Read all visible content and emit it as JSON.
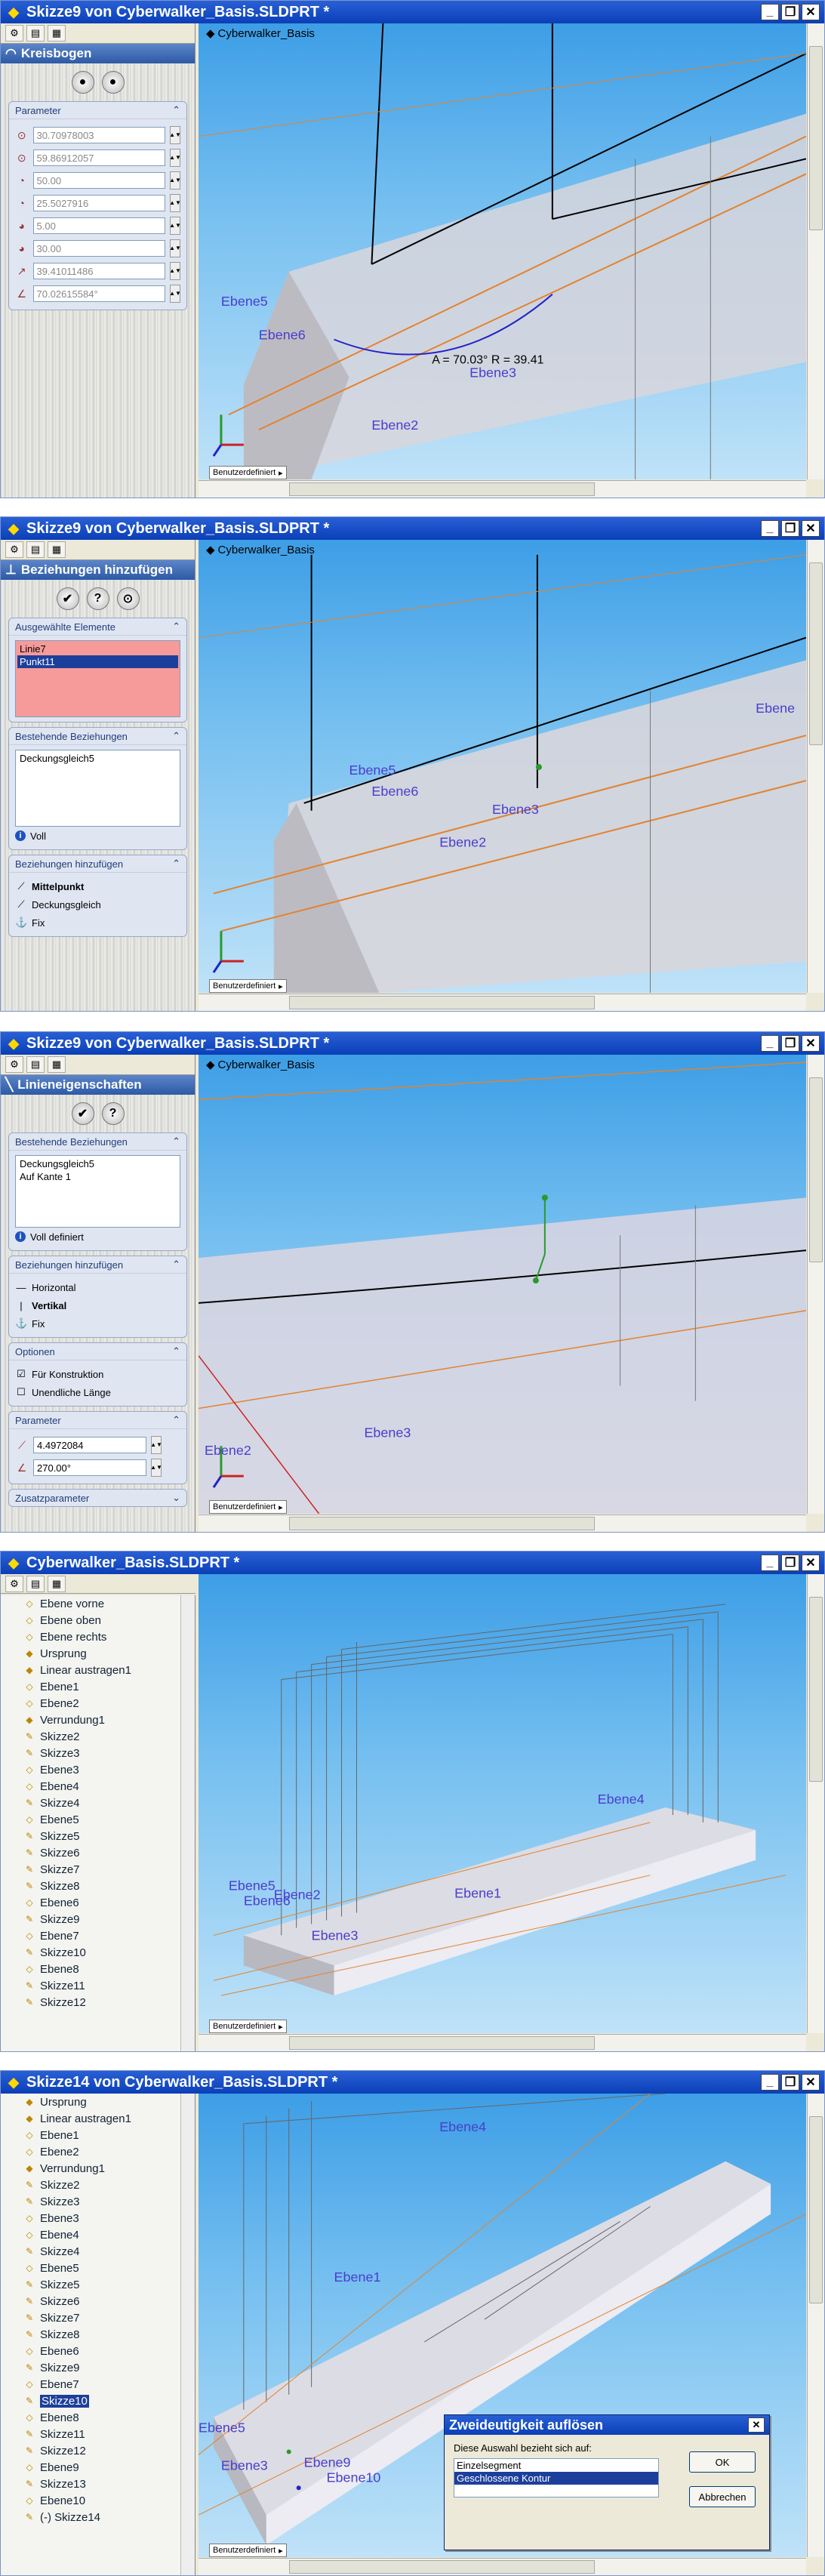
{
  "w1": {
    "title": "Skizze9 von Cyberwalker_Basis.SLDPRT *",
    "pm_title": "Kreisbogen",
    "param_label": "Parameter",
    "params": [
      "30.70978003",
      "59.86912057",
      "50.00",
      "25.5027916",
      "5.00",
      "30.00",
      "39.41011486",
      "70.02615584°"
    ],
    "viewport_title": "Cyberwalker_Basis",
    "annotation": "A = 70.03° R = 39.41",
    "labels": [
      "Ebene5",
      "Ebene6",
      "Ebene3",
      "Ebene2"
    ],
    "view_tab": "Benutzerdefiniert"
  },
  "w2": {
    "title": "Skizze9 von Cyberwalker_Basis.SLDPRT *",
    "pm_title": "Beziehungen hinzufügen",
    "selected_label": "Ausgewählte Elemente",
    "selected": [
      "Linie7",
      "Punkt11"
    ],
    "existing_label": "Bestehende Beziehungen",
    "existing": [
      "Deckungsgleich5"
    ],
    "status": "Voll",
    "add_label": "Beziehungen hinzufügen",
    "add": [
      "Mittelpunkt",
      "Deckungsgleich",
      "Fix"
    ],
    "viewport_title": "Cyberwalker_Basis",
    "labels": [
      "Ebene5",
      "Ebene6",
      "Ebene3",
      "Ebene2",
      "Ebene"
    ],
    "view_tab": "Benutzerdefiniert"
  },
  "w3": {
    "title": "Skizze9 von Cyberwalker_Basis.SLDPRT *",
    "pm_title": "Linieneigenschaften",
    "existing_label": "Bestehende Beziehungen",
    "existing": [
      "Deckungsgleich5",
      "Auf Kante 1"
    ],
    "status": "Voll definiert",
    "add_label": "Beziehungen hinzufügen",
    "add": [
      "Horizontal",
      "Vertikal",
      "Fix"
    ],
    "options_label": "Optionen",
    "options": [
      "Für Konstruktion",
      "Unendliche Länge"
    ],
    "param_label": "Parameter",
    "params": [
      "4.4972084",
      "270.00°"
    ],
    "extra_label": "Zusatzparameter",
    "viewport_title": "Cyberwalker_Basis",
    "labels": [
      "Ebene2",
      "Ebene3"
    ],
    "view_tab": "Benutzerdefiniert"
  },
  "w4": {
    "title": "Cyberwalker_Basis.SLDPRT *",
    "tree": [
      "Ebene vorne",
      "Ebene oben",
      "Ebene rechts",
      "Ursprung",
      "Linear austragen1",
      "Ebene1",
      "Ebene2",
      "Verrundung1",
      "Skizze2",
      "Skizze3",
      "Ebene3",
      "Ebene4",
      "Skizze4",
      "Ebene5",
      "Skizze5",
      "Skizze6",
      "Skizze7",
      "Skizze8",
      "Ebene6",
      "Skizze9",
      "Ebene7",
      "Skizze10",
      "Ebene8",
      "Skizze11",
      "Skizze12"
    ],
    "labels": [
      "Ebene4",
      "Ebene1",
      "Ebene5",
      "Ebene6",
      "Ebene2",
      "Ebene3"
    ],
    "view_tab": "Benutzerdefiniert"
  },
  "w5": {
    "title": "Skizze14 von Cyberwalker_Basis.SLDPRT *",
    "tree": [
      "Ursprung",
      "Linear austragen1",
      "Ebene1",
      "Ebene2",
      "Verrundung1",
      "Skizze2",
      "Skizze3",
      "Ebene3",
      "Ebene4",
      "Skizze4",
      "Ebene5",
      "Skizze5",
      "Skizze6",
      "Skizze7",
      "Skizze8",
      "Ebene6",
      "Skizze9",
      "Ebene7",
      "Skizze10",
      "Ebene8",
      "Skizze11",
      "Skizze12",
      "Ebene9",
      "Skizze13",
      "Ebene10",
      "(-) Skizze14"
    ],
    "selected_item": "Skizze10",
    "labels": [
      "Ebene4",
      "Ebene1",
      "Ebene5",
      "Ebene3",
      "Ebene9",
      "Ebene10"
    ],
    "view_tab": "Benutzerdefiniert",
    "dialog": {
      "title": "Zweideutigkeit auflösen",
      "prompt": "Diese Auswahl bezieht sich auf:",
      "options": [
        "Einzelsegment",
        "Geschlossene Kontur"
      ],
      "ok": "OK",
      "cancel": "Abbrechen"
    }
  },
  "colors": {
    "title_bar": "#0a3fb7",
    "viewport_top": "#3d9ee6",
    "viewport_bottom": "#bfe2f8",
    "plane_label": "#4a3ecc",
    "highlight": "#1d3f9c",
    "error": "#f79a9a"
  }
}
